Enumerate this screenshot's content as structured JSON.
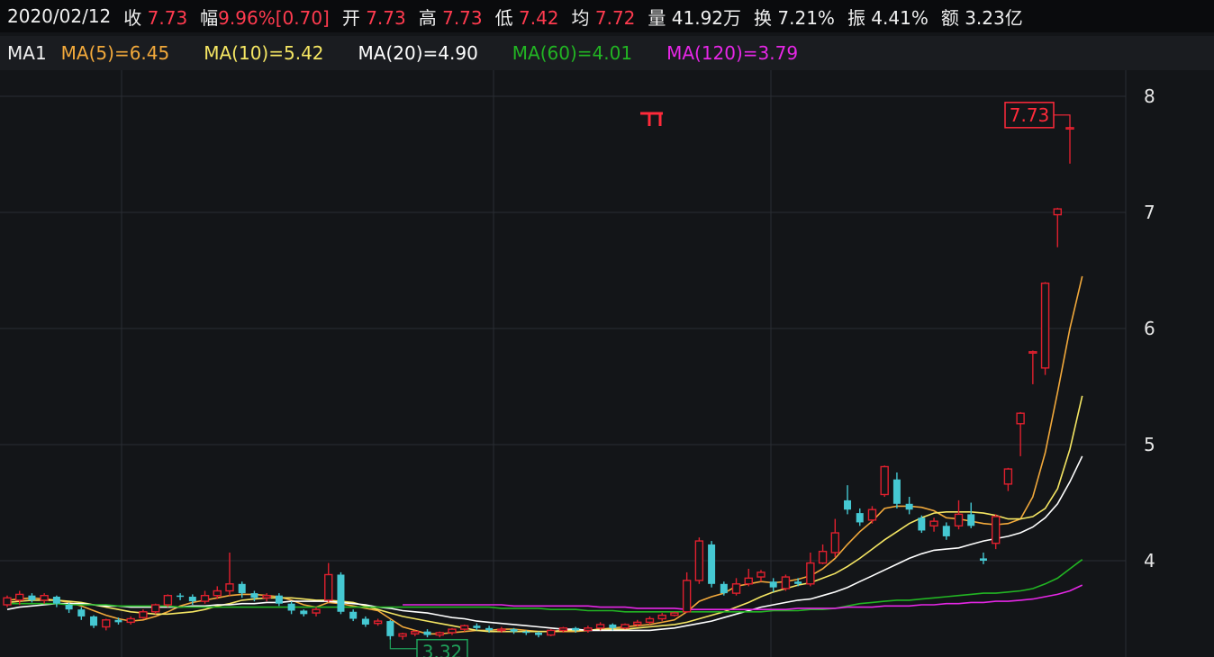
{
  "quote": {
    "date": "2020/02/12",
    "close_label": "收",
    "close": "7.73",
    "change_label": "幅",
    "change": "9.96%[0.70]",
    "open_label": "开",
    "open": "7.73",
    "high_label": "高",
    "high": "7.73",
    "low_label": "低",
    "low": "7.42",
    "avg_label": "均",
    "avg": "7.72",
    "volume_label": "量",
    "volume": "41.92万",
    "turnover_label": "换",
    "turnover": "7.21%",
    "amplitude_label": "振",
    "amplitude": "4.41%",
    "amount_label": "额",
    "amount": "3.23亿"
  },
  "ma_legend": {
    "title": "MA1",
    "ma5": "MA(5)=6.45",
    "ma10": "MA(10)=5.42",
    "ma20": "MA(20)=4.90",
    "ma60": "MA(60)=4.01",
    "ma120": "MA(120)=3.79"
  },
  "colors": {
    "up": "#e0202e",
    "down": "#45c8d2",
    "ma5": "#f2a93b",
    "ma10": "#f5e663",
    "ma20": "#ffffff",
    "ma60": "#22b523",
    "ma120": "#e627e6",
    "grid": "#2a2d33",
    "high_marker": "#ff2a3a",
    "low_marker": "#1fa15a"
  },
  "chart_data": {
    "type": "candlestick",
    "y_ticks": [
      "8",
      "7",
      "6",
      "5",
      "4"
    ],
    "ylim": [
      3.2,
      8.2
    ],
    "annotations": {
      "high": "7.73",
      "low": "3.32"
    },
    "candles": [
      [
        3.62,
        3.68,
        3.6,
        3.7
      ],
      [
        3.66,
        3.71,
        3.62,
        3.74
      ],
      [
        3.7,
        3.66,
        3.64,
        3.72
      ],
      [
        3.66,
        3.7,
        3.63,
        3.72
      ],
      [
        3.69,
        3.63,
        3.6,
        3.7
      ],
      [
        3.62,
        3.58,
        3.55,
        3.64
      ],
      [
        3.58,
        3.52,
        3.49,
        3.6
      ],
      [
        3.52,
        3.44,
        3.42,
        3.53
      ],
      [
        3.43,
        3.49,
        3.4,
        3.5
      ],
      [
        3.49,
        3.47,
        3.45,
        3.51
      ],
      [
        3.47,
        3.5,
        3.45,
        3.52
      ],
      [
        3.51,
        3.56,
        3.5,
        3.58
      ],
      [
        3.56,
        3.62,
        3.54,
        3.63
      ],
      [
        3.62,
        3.7,
        3.6,
        3.71
      ],
      [
        3.7,
        3.69,
        3.66,
        3.72
      ],
      [
        3.69,
        3.65,
        3.62,
        3.71
      ],
      [
        3.65,
        3.7,
        3.63,
        3.74
      ],
      [
        3.7,
        3.74,
        3.67,
        3.78
      ],
      [
        3.74,
        3.8,
        3.7,
        4.07
      ],
      [
        3.8,
        3.72,
        3.68,
        3.82
      ],
      [
        3.72,
        3.68,
        3.65,
        3.74
      ],
      [
        3.68,
        3.7,
        3.65,
        3.72
      ],
      [
        3.7,
        3.63,
        3.61,
        3.72
      ],
      [
        3.63,
        3.57,
        3.54,
        3.65
      ],
      [
        3.57,
        3.54,
        3.52,
        3.58
      ],
      [
        3.55,
        3.58,
        3.52,
        3.6
      ],
      [
        3.66,
        3.88,
        3.64,
        3.98
      ],
      [
        3.88,
        3.56,
        3.54,
        3.9
      ],
      [
        3.56,
        3.5,
        3.48,
        3.58
      ],
      [
        3.5,
        3.45,
        3.43,
        3.52
      ],
      [
        3.46,
        3.48,
        3.44,
        3.5
      ],
      [
        3.48,
        3.35,
        3.32,
        3.49
      ],
      [
        3.35,
        3.37,
        3.32,
        3.38
      ],
      [
        3.37,
        3.39,
        3.35,
        3.4
      ],
      [
        3.39,
        3.36,
        3.34,
        3.41
      ],
      [
        3.36,
        3.38,
        3.34,
        3.39
      ],
      [
        3.38,
        3.41,
        3.36,
        3.42
      ],
      [
        3.41,
        3.44,
        3.39,
        3.45
      ],
      [
        3.44,
        3.42,
        3.4,
        3.46
      ],
      [
        3.42,
        3.4,
        3.38,
        3.44
      ],
      [
        3.4,
        3.41,
        3.38,
        3.43
      ],
      [
        3.41,
        3.39,
        3.37,
        3.42
      ],
      [
        3.39,
        3.38,
        3.36,
        3.4
      ],
      [
        3.38,
        3.36,
        3.34,
        3.39
      ],
      [
        3.36,
        3.4,
        3.35,
        3.41
      ],
      [
        3.4,
        3.42,
        3.38,
        3.43
      ],
      [
        3.42,
        3.4,
        3.38,
        3.43
      ],
      [
        3.4,
        3.42,
        3.38,
        3.44
      ],
      [
        3.42,
        3.45,
        3.4,
        3.47
      ],
      [
        3.45,
        3.42,
        3.4,
        3.46
      ],
      [
        3.42,
        3.45,
        3.41,
        3.46
      ],
      [
        3.45,
        3.47,
        3.43,
        3.49
      ],
      [
        3.47,
        3.5,
        3.45,
        3.52
      ],
      [
        3.5,
        3.53,
        3.48,
        3.55
      ],
      [
        3.53,
        3.55,
        3.52,
        3.56
      ],
      [
        3.56,
        3.83,
        3.55,
        3.9
      ],
      [
        3.83,
        4.17,
        3.8,
        4.2
      ],
      [
        4.14,
        3.8,
        3.77,
        4.17
      ],
      [
        3.8,
        3.72,
        3.7,
        3.82
      ],
      [
        3.72,
        3.8,
        3.7,
        3.85
      ],
      [
        3.8,
        3.85,
        3.78,
        3.93
      ],
      [
        3.86,
        3.9,
        3.82,
        3.92
      ],
      [
        3.82,
        3.77,
        3.73,
        3.85
      ],
      [
        3.76,
        3.86,
        3.74,
        3.88
      ],
      [
        3.82,
        3.8,
        3.78,
        3.85
      ],
      [
        3.8,
        3.98,
        3.78,
        4.07
      ],
      [
        3.98,
        4.08,
        3.97,
        4.14
      ],
      [
        4.07,
        4.24,
        4.03,
        4.36
      ],
      [
        4.52,
        4.44,
        4.4,
        4.65
      ],
      [
        4.41,
        4.33,
        4.3,
        4.45
      ],
      [
        4.35,
        4.44,
        4.32,
        4.47
      ],
      [
        4.57,
        4.81,
        4.55,
        4.82
      ],
      [
        4.7,
        4.49,
        4.45,
        4.76
      ],
      [
        4.49,
        4.44,
        4.4,
        4.55
      ],
      [
        4.37,
        4.26,
        4.24,
        4.39
      ],
      [
        4.3,
        4.34,
        4.25,
        4.37
      ],
      [
        4.3,
        4.21,
        4.18,
        4.33
      ],
      [
        4.3,
        4.4,
        4.27,
        4.52
      ],
      [
        4.4,
        4.3,
        4.28,
        4.5
      ],
      [
        4.02,
        4.0,
        3.97,
        4.07
      ],
      [
        4.15,
        4.38,
        4.1,
        4.4
      ],
      [
        4.66,
        4.79,
        4.6,
        4.8
      ],
      [
        5.18,
        5.27,
        4.9,
        5.28
      ],
      [
        5.8,
        5.8,
        5.52,
        5.81
      ],
      [
        5.66,
        6.39,
        5.6,
        6.4
      ],
      [
        6.98,
        7.03,
        6.7,
        7.04
      ],
      [
        7.73,
        7.73,
        7.42,
        7.73
      ]
    ],
    "series": [
      {
        "name": "MA(5)",
        "values": [
          3.66,
          3.67,
          3.68,
          3.67,
          3.66,
          3.64,
          3.61,
          3.57,
          3.53,
          3.5,
          3.48,
          3.49,
          3.52,
          3.56,
          3.61,
          3.64,
          3.66,
          3.68,
          3.7,
          3.71,
          3.71,
          3.7,
          3.69,
          3.66,
          3.62,
          3.6,
          3.64,
          3.63,
          3.61,
          3.59,
          3.57,
          3.5,
          3.43,
          3.4,
          3.37,
          3.37,
          3.38,
          3.39,
          3.4,
          3.4,
          3.41,
          3.41,
          3.4,
          3.39,
          3.39,
          3.39,
          3.39,
          3.4,
          3.41,
          3.42,
          3.43,
          3.44,
          3.45,
          3.47,
          3.49,
          3.56,
          3.65,
          3.69,
          3.72,
          3.78,
          3.8,
          3.82,
          3.81,
          3.82,
          3.84,
          3.87,
          3.93,
          4.02,
          4.14,
          4.25,
          4.34,
          4.45,
          4.47,
          4.47,
          4.46,
          4.43,
          4.37,
          4.36,
          4.34,
          4.32,
          4.31,
          4.32,
          4.36,
          4.55,
          4.93,
          5.45,
          6.0,
          6.45
        ]
      },
      {
        "name": "MA(10)",
        "values": [
          3.64,
          3.65,
          3.66,
          3.66,
          3.66,
          3.65,
          3.64,
          3.62,
          3.6,
          3.58,
          3.56,
          3.55,
          3.54,
          3.54,
          3.55,
          3.56,
          3.58,
          3.61,
          3.63,
          3.66,
          3.67,
          3.68,
          3.68,
          3.68,
          3.67,
          3.66,
          3.66,
          3.65,
          3.64,
          3.61,
          3.58,
          3.55,
          3.52,
          3.5,
          3.48,
          3.46,
          3.44,
          3.42,
          3.4,
          3.39,
          3.39,
          3.39,
          3.39,
          3.39,
          3.39,
          3.4,
          3.4,
          3.4,
          3.41,
          3.41,
          3.41,
          3.42,
          3.43,
          3.44,
          3.45,
          3.47,
          3.5,
          3.53,
          3.56,
          3.6,
          3.64,
          3.69,
          3.73,
          3.76,
          3.79,
          3.81,
          3.85,
          3.89,
          3.95,
          4.02,
          4.1,
          4.18,
          4.25,
          4.32,
          4.37,
          4.41,
          4.42,
          4.42,
          4.42,
          4.41,
          4.39,
          4.36,
          4.36,
          4.38,
          4.45,
          4.62,
          4.96,
          5.42
        ]
      },
      {
        "name": "MA(20)",
        "values": [
          3.58,
          3.6,
          3.61,
          3.62,
          3.63,
          3.63,
          3.63,
          3.62,
          3.61,
          3.61,
          3.6,
          3.6,
          3.6,
          3.6,
          3.6,
          3.61,
          3.61,
          3.62,
          3.62,
          3.63,
          3.63,
          3.64,
          3.64,
          3.65,
          3.65,
          3.65,
          3.65,
          3.64,
          3.63,
          3.62,
          3.6,
          3.59,
          3.57,
          3.56,
          3.55,
          3.53,
          3.51,
          3.5,
          3.48,
          3.47,
          3.46,
          3.45,
          3.44,
          3.43,
          3.42,
          3.41,
          3.41,
          3.4,
          3.4,
          3.4,
          3.4,
          3.4,
          3.4,
          3.41,
          3.42,
          3.44,
          3.46,
          3.48,
          3.51,
          3.54,
          3.57,
          3.6,
          3.62,
          3.64,
          3.66,
          3.67,
          3.7,
          3.73,
          3.77,
          3.82,
          3.87,
          3.92,
          3.97,
          4.02,
          4.06,
          4.09,
          4.1,
          4.11,
          4.14,
          4.17,
          4.19,
          4.21,
          4.24,
          4.29,
          4.37,
          4.49,
          4.68,
          4.9
        ]
      },
      {
        "name": "MA(60)",
        "values": [
          3.63,
          3.63,
          3.63,
          3.63,
          3.63,
          3.62,
          3.62,
          3.62,
          3.62,
          3.61,
          3.61,
          3.61,
          3.61,
          3.61,
          3.6,
          3.6,
          3.6,
          3.6,
          3.6,
          3.6,
          3.6,
          3.6,
          3.6,
          3.6,
          3.6,
          3.6,
          3.6,
          3.6,
          3.6,
          3.6,
          3.6,
          3.6,
          3.6,
          3.6,
          3.6,
          3.6,
          3.6,
          3.6,
          3.6,
          3.6,
          3.59,
          3.59,
          3.59,
          3.59,
          3.58,
          3.58,
          3.58,
          3.57,
          3.57,
          3.57,
          3.56,
          3.56,
          3.56,
          3.56,
          3.56,
          3.56,
          3.56,
          3.56,
          3.56,
          3.56,
          3.56,
          3.56,
          3.57,
          3.57,
          3.57,
          3.58,
          3.58,
          3.59,
          3.61,
          3.63,
          3.64,
          3.65,
          3.66,
          3.66,
          3.67,
          3.68,
          3.69,
          3.7,
          3.71,
          3.72,
          3.72,
          3.73,
          3.74,
          3.76,
          3.8,
          3.85,
          3.93,
          4.01
        ]
      },
      {
        "name": "MA(120)",
        "values": [
          null,
          null,
          null,
          null,
          null,
          null,
          null,
          null,
          null,
          null,
          null,
          null,
          null,
          null,
          null,
          null,
          null,
          null,
          null,
          null,
          null,
          null,
          null,
          null,
          null,
          null,
          null,
          null,
          null,
          null,
          null,
          null,
          3.62,
          3.62,
          3.62,
          3.62,
          3.62,
          3.62,
          3.62,
          3.62,
          3.62,
          3.61,
          3.61,
          3.61,
          3.61,
          3.61,
          3.61,
          3.61,
          3.6,
          3.6,
          3.6,
          3.59,
          3.59,
          3.59,
          3.59,
          3.58,
          3.58,
          3.58,
          3.58,
          3.58,
          3.58,
          3.58,
          3.58,
          3.58,
          3.59,
          3.59,
          3.59,
          3.59,
          3.6,
          3.6,
          3.6,
          3.61,
          3.61,
          3.61,
          3.62,
          3.62,
          3.63,
          3.63,
          3.64,
          3.64,
          3.65,
          3.65,
          3.66,
          3.67,
          3.69,
          3.71,
          3.74,
          3.79
        ]
      }
    ]
  }
}
